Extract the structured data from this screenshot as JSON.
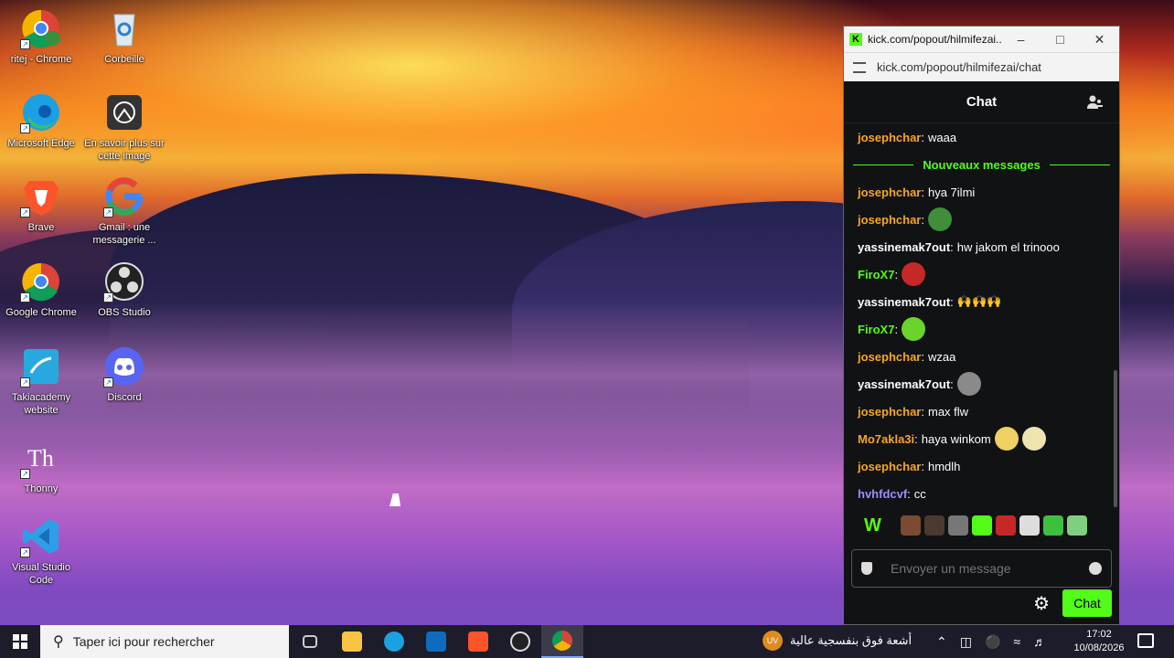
{
  "desktop": {
    "icons": [
      {
        "label": "ritej - Chrome",
        "icon": "chrome-profile-icon"
      },
      {
        "label": "Corbeille",
        "icon": "recycle-bin-icon"
      },
      {
        "label": "Microsoft Edge",
        "icon": "edge-icon"
      },
      {
        "label": "En savoir plus sur cette image",
        "icon": "camera-icon"
      },
      {
        "label": "Brave",
        "icon": "brave-icon"
      },
      {
        "label": "Gmail : une messagerie ...",
        "icon": "google-icon"
      },
      {
        "label": "Google Chrome",
        "icon": "chrome-icon"
      },
      {
        "label": "OBS Studio",
        "icon": "obs-icon"
      },
      {
        "label": "Takiacademy website",
        "icon": "takiacademy-icon"
      },
      {
        "label": "Discord",
        "icon": "discord-icon"
      },
      {
        "label": "Thonny",
        "icon": "thonny-icon"
      },
      {
        "label": "Visual Studio Code",
        "icon": "vscode-icon"
      }
    ]
  },
  "chat_window": {
    "title": "kick.com/popout/hilmifezai...",
    "url": "kick.com/popout/hilmifezai/chat",
    "header_title": "Chat",
    "new_messages_label": "Nouveaux messages",
    "messages_before": [
      {
        "user": "josephchar",
        "sep": ":",
        "text": "waaa",
        "color": "#f5a623",
        "emotes": []
      }
    ],
    "messages": [
      {
        "user": "josephchar",
        "sep": ":",
        "text": "hya 7ilmi",
        "color": "#f5a623",
        "emotes": []
      },
      {
        "user": "josephchar",
        "sep": ":",
        "text": "",
        "color": "#f5a623",
        "emotes": [
          "#3e8e3a"
        ]
      },
      {
        "user": "yassinemak7out",
        "sep": ":",
        "text": "hw jakom el trinooo",
        "color": "#ffffff",
        "emotes": []
      },
      {
        "user": "FiroX7",
        "sep": ":",
        "text": "",
        "color": "#53fc18",
        "emotes": [
          "#c62828"
        ]
      },
      {
        "user": "yassinemak7out",
        "sep": ":",
        "text": "🙌🙌🙌",
        "color": "#ffffff",
        "emotes": []
      },
      {
        "user": "FiroX7",
        "sep": ":",
        "text": "",
        "color": "#53fc18",
        "emotes": [
          "#6bd42c"
        ]
      },
      {
        "user": "josephchar",
        "sep": ":",
        "text": "wzaa",
        "color": "#f5a623",
        "emotes": []
      },
      {
        "user": "yassinemak7out",
        "sep": ":",
        "text": "",
        "color": "#ffffff",
        "emotes": [
          "#8a8a8a"
        ]
      },
      {
        "user": "josephchar",
        "sep": ":",
        "text": "max flw",
        "color": "#f5a623",
        "emotes": []
      },
      {
        "user": "Mo7akla3i",
        "sep": ":",
        "text": "haya winkom",
        "color": "#f5a623",
        "emotes": [
          "#f0d060",
          "#efe3b0"
        ]
      },
      {
        "user": "josephchar",
        "sep": ":",
        "text": "hmdlh",
        "color": "#f5a623",
        "emotes": []
      },
      {
        "user": "hvhfdcvf",
        "sep": ":",
        "text": "cc",
        "color": "#9c8cff",
        "emotes": []
      }
    ],
    "emote_bar": {
      "first": "W",
      "emotes": [
        "#7a4b32",
        "#4b3a30",
        "#777777",
        "#53fc18",
        "#c62828",
        "#dddddd",
        "#3fbf3f",
        "#7fcf7f"
      ]
    },
    "input_placeholder": "Envoyer un message",
    "send_label": "Chat"
  },
  "taskbar": {
    "search_placeholder": "Taper ici pour rechercher",
    "apps": [
      "task-view-icon",
      "file-explorer-icon",
      "edge-icon",
      "outlook-icon",
      "brave-icon",
      "obs-icon",
      "chrome-icon"
    ],
    "weather_badge": "UV",
    "weather_text": "أشعة فوق بنفسجية عالية",
    "time": "17:02",
    "date": "10/08/2026"
  }
}
